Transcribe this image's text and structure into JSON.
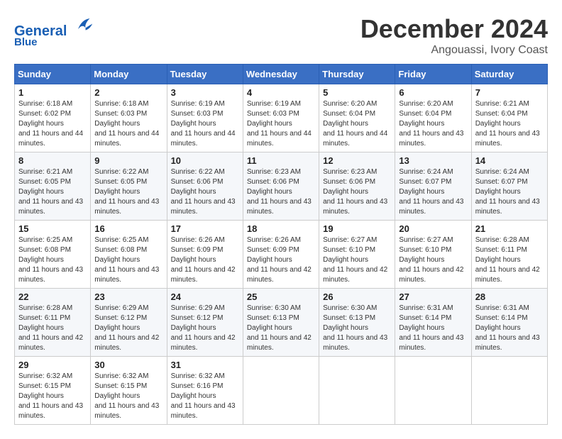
{
  "header": {
    "logo_line1": "General",
    "logo_line2": "Blue",
    "month_title": "December 2024",
    "location": "Angouassi, Ivory Coast"
  },
  "weekdays": [
    "Sunday",
    "Monday",
    "Tuesday",
    "Wednesday",
    "Thursday",
    "Friday",
    "Saturday"
  ],
  "weeks": [
    [
      {
        "day": "1",
        "sunrise": "6:18 AM",
        "sunset": "6:02 PM",
        "daylight": "11 hours and 44 minutes."
      },
      {
        "day": "2",
        "sunrise": "6:18 AM",
        "sunset": "6:03 PM",
        "daylight": "11 hours and 44 minutes."
      },
      {
        "day": "3",
        "sunrise": "6:19 AM",
        "sunset": "6:03 PM",
        "daylight": "11 hours and 44 minutes."
      },
      {
        "day": "4",
        "sunrise": "6:19 AM",
        "sunset": "6:03 PM",
        "daylight": "11 hours and 44 minutes."
      },
      {
        "day": "5",
        "sunrise": "6:20 AM",
        "sunset": "6:04 PM",
        "daylight": "11 hours and 44 minutes."
      },
      {
        "day": "6",
        "sunrise": "6:20 AM",
        "sunset": "6:04 PM",
        "daylight": "11 hours and 43 minutes."
      },
      {
        "day": "7",
        "sunrise": "6:21 AM",
        "sunset": "6:04 PM",
        "daylight": "11 hours and 43 minutes."
      }
    ],
    [
      {
        "day": "8",
        "sunrise": "6:21 AM",
        "sunset": "6:05 PM",
        "daylight": "11 hours and 43 minutes."
      },
      {
        "day": "9",
        "sunrise": "6:22 AM",
        "sunset": "6:05 PM",
        "daylight": "11 hours and 43 minutes."
      },
      {
        "day": "10",
        "sunrise": "6:22 AM",
        "sunset": "6:06 PM",
        "daylight": "11 hours and 43 minutes."
      },
      {
        "day": "11",
        "sunrise": "6:23 AM",
        "sunset": "6:06 PM",
        "daylight": "11 hours and 43 minutes."
      },
      {
        "day": "12",
        "sunrise": "6:23 AM",
        "sunset": "6:06 PM",
        "daylight": "11 hours and 43 minutes."
      },
      {
        "day": "13",
        "sunrise": "6:24 AM",
        "sunset": "6:07 PM",
        "daylight": "11 hours and 43 minutes."
      },
      {
        "day": "14",
        "sunrise": "6:24 AM",
        "sunset": "6:07 PM",
        "daylight": "11 hours and 43 minutes."
      }
    ],
    [
      {
        "day": "15",
        "sunrise": "6:25 AM",
        "sunset": "6:08 PM",
        "daylight": "11 hours and 43 minutes."
      },
      {
        "day": "16",
        "sunrise": "6:25 AM",
        "sunset": "6:08 PM",
        "daylight": "11 hours and 43 minutes."
      },
      {
        "day": "17",
        "sunrise": "6:26 AM",
        "sunset": "6:09 PM",
        "daylight": "11 hours and 42 minutes."
      },
      {
        "day": "18",
        "sunrise": "6:26 AM",
        "sunset": "6:09 PM",
        "daylight": "11 hours and 42 minutes."
      },
      {
        "day": "19",
        "sunrise": "6:27 AM",
        "sunset": "6:10 PM",
        "daylight": "11 hours and 42 minutes."
      },
      {
        "day": "20",
        "sunrise": "6:27 AM",
        "sunset": "6:10 PM",
        "daylight": "11 hours and 42 minutes."
      },
      {
        "day": "21",
        "sunrise": "6:28 AM",
        "sunset": "6:11 PM",
        "daylight": "11 hours and 42 minutes."
      }
    ],
    [
      {
        "day": "22",
        "sunrise": "6:28 AM",
        "sunset": "6:11 PM",
        "daylight": "11 hours and 42 minutes."
      },
      {
        "day": "23",
        "sunrise": "6:29 AM",
        "sunset": "6:12 PM",
        "daylight": "11 hours and 42 minutes."
      },
      {
        "day": "24",
        "sunrise": "6:29 AM",
        "sunset": "6:12 PM",
        "daylight": "11 hours and 42 minutes."
      },
      {
        "day": "25",
        "sunrise": "6:30 AM",
        "sunset": "6:13 PM",
        "daylight": "11 hours and 42 minutes."
      },
      {
        "day": "26",
        "sunrise": "6:30 AM",
        "sunset": "6:13 PM",
        "daylight": "11 hours and 43 minutes."
      },
      {
        "day": "27",
        "sunrise": "6:31 AM",
        "sunset": "6:14 PM",
        "daylight": "11 hours and 43 minutes."
      },
      {
        "day": "28",
        "sunrise": "6:31 AM",
        "sunset": "6:14 PM",
        "daylight": "11 hours and 43 minutes."
      }
    ],
    [
      {
        "day": "29",
        "sunrise": "6:32 AM",
        "sunset": "6:15 PM",
        "daylight": "11 hours and 43 minutes."
      },
      {
        "day": "30",
        "sunrise": "6:32 AM",
        "sunset": "6:15 PM",
        "daylight": "11 hours and 43 minutes."
      },
      {
        "day": "31",
        "sunrise": "6:32 AM",
        "sunset": "6:16 PM",
        "daylight": "11 hours and 43 minutes."
      },
      null,
      null,
      null,
      null
    ]
  ]
}
